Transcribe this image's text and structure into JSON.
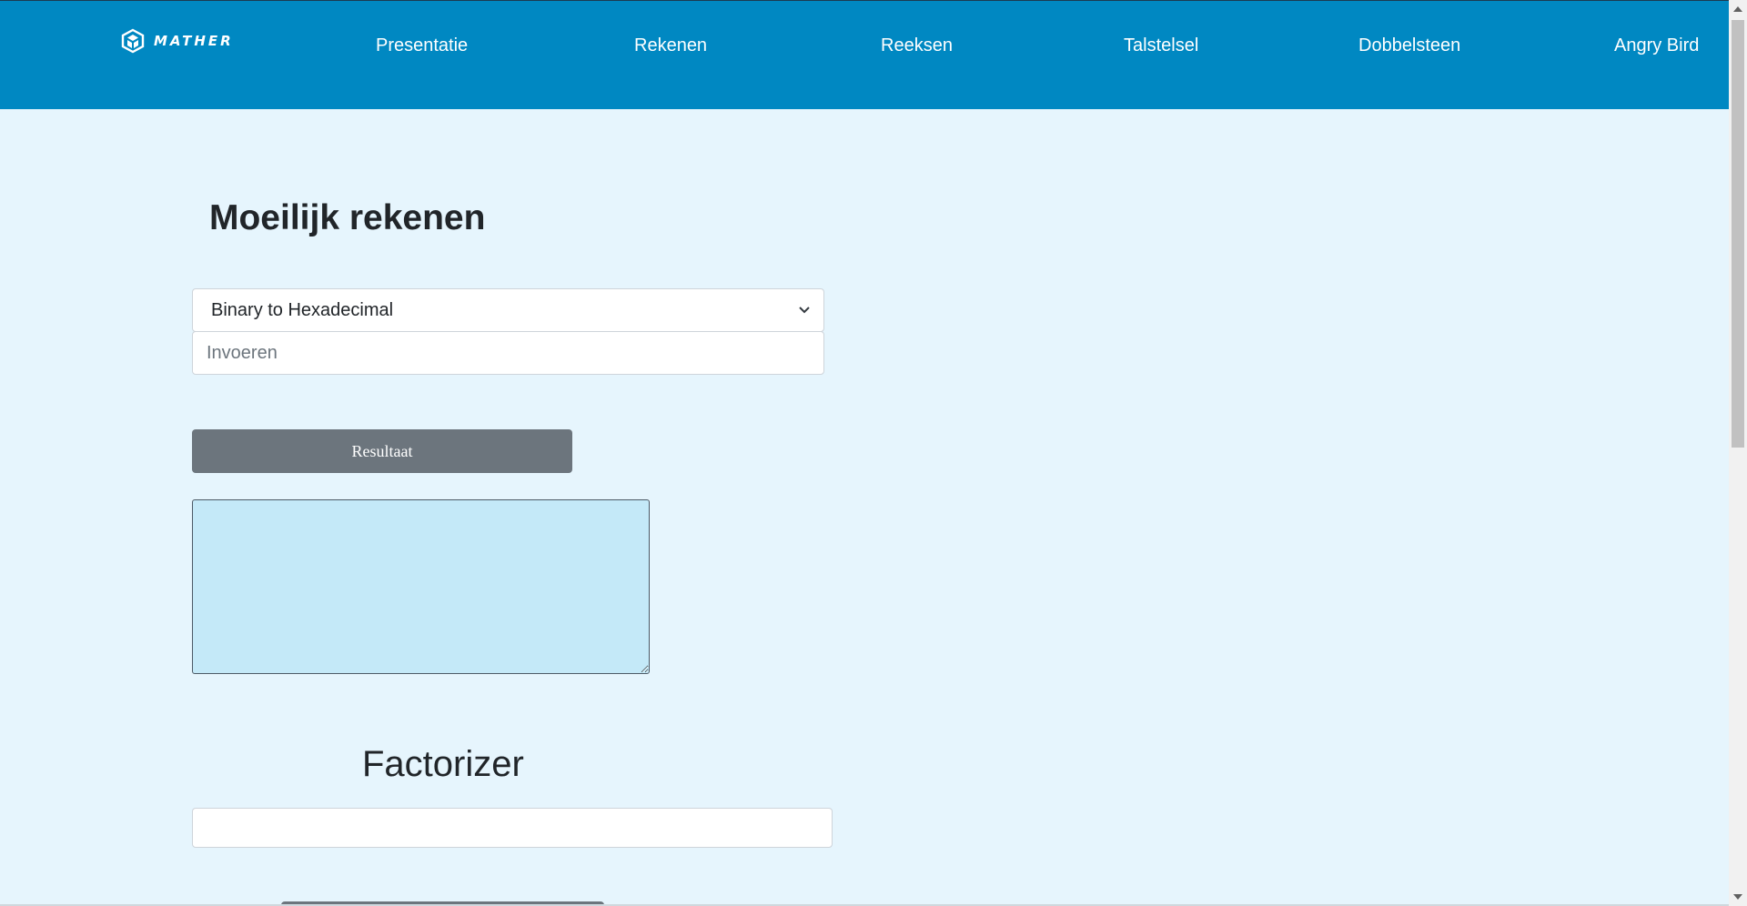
{
  "navbar": {
    "brand": "MATHER",
    "links": [
      {
        "label": "Presentatie"
      },
      {
        "label": "Rekenen"
      },
      {
        "label": "Reeksen"
      },
      {
        "label": "Talstelsel"
      },
      {
        "label": "Dobbelsteen"
      },
      {
        "label": "Angry Bird"
      }
    ],
    "color": "#0088c2"
  },
  "main": {
    "title": "Moeilijk rekenen",
    "conversion_select": {
      "selected": "Binary to Hexadecimal"
    },
    "input": {
      "placeholder": "Invoeren",
      "value": ""
    },
    "result_button": "Resultaat",
    "output": "",
    "factorizer": {
      "title": "Factorizer",
      "input_value": ""
    }
  },
  "colors": {
    "page_background": "#e6f5fd",
    "output_background": "#c4e9f8",
    "button": "#6c757d"
  }
}
